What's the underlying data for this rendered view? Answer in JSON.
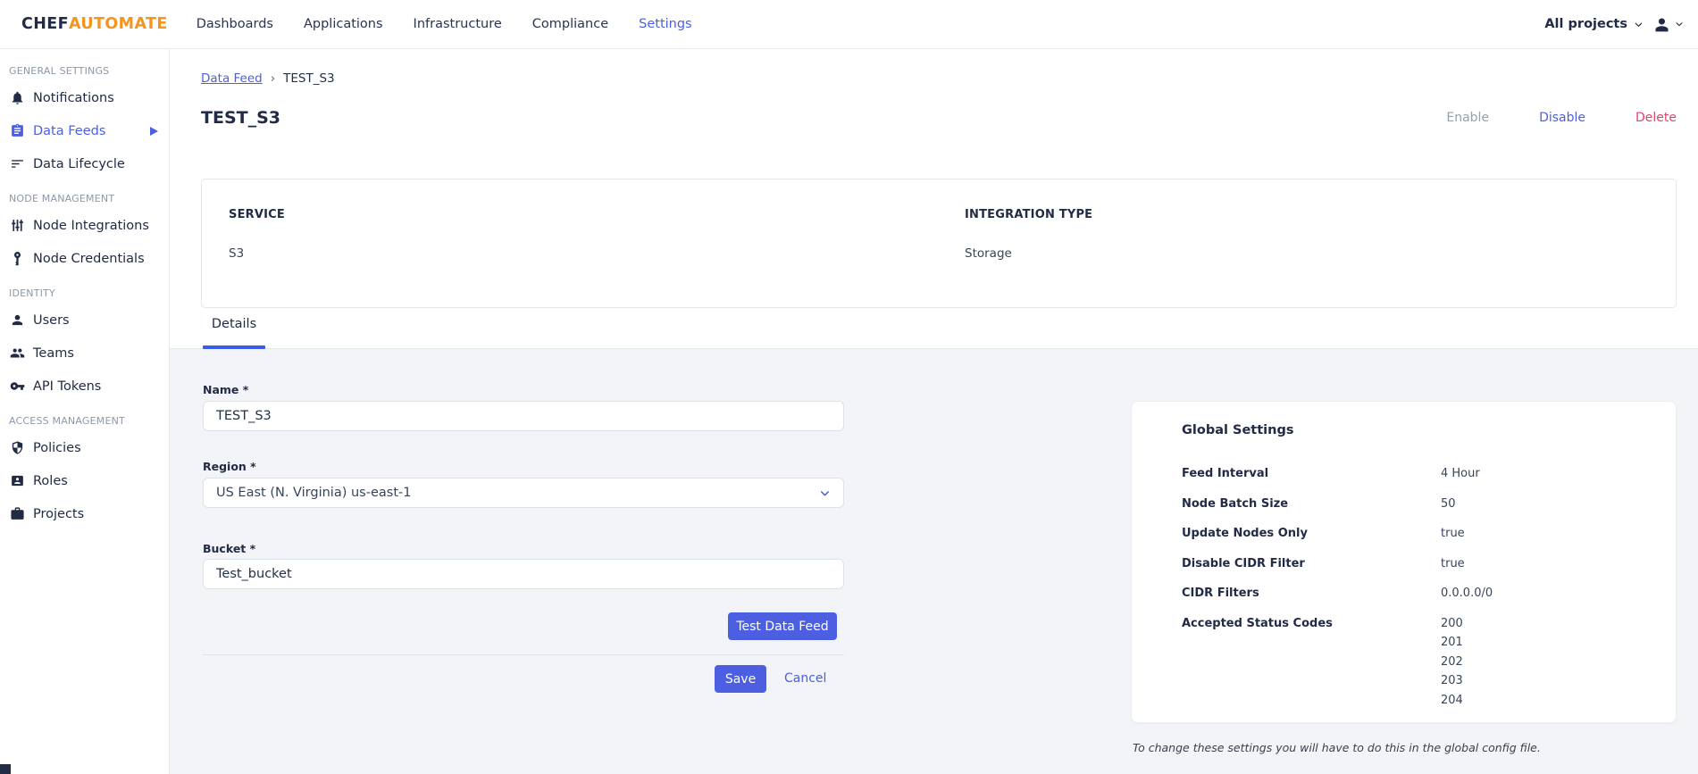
{
  "brand": {
    "chef": "CHEF",
    "automate": "AUTOMATE"
  },
  "navbar": {
    "items": [
      {
        "label": "Dashboards",
        "active": false
      },
      {
        "label": "Applications",
        "active": false
      },
      {
        "label": "Infrastructure",
        "active": false
      },
      {
        "label": "Compliance",
        "active": false
      },
      {
        "label": "Settings",
        "active": true
      }
    ],
    "projects_filter": "All projects",
    "icons": [
      "chevron-down-icon",
      "user-avatar-icon",
      "chevron-down-icon"
    ]
  },
  "sidebar": {
    "sections": [
      {
        "heading": "GENERAL SETTINGS",
        "items": [
          {
            "label": "Notifications",
            "icon": "bell-icon",
            "active": false
          },
          {
            "label": "Data Feeds",
            "icon": "clipboard-icon",
            "active": true,
            "expanded_arrow": "right-triangle-icon"
          },
          {
            "label": "Data Lifecycle",
            "icon": "list-icon",
            "active": false
          }
        ]
      },
      {
        "heading": "NODE MANAGEMENT",
        "items": [
          {
            "label": "Node Integrations",
            "icon": "sliders-icon",
            "active": false
          },
          {
            "label": "Node Credentials",
            "icon": "key-vertical-icon",
            "active": false
          }
        ]
      },
      {
        "heading": "IDENTITY",
        "items": [
          {
            "label": "Users",
            "icon": "user-icon",
            "active": false
          },
          {
            "label": "Teams",
            "icon": "team-icon",
            "active": false
          },
          {
            "label": "API Tokens",
            "icon": "key-icon",
            "active": false
          }
        ]
      },
      {
        "heading": "ACCESS MANAGEMENT",
        "items": [
          {
            "label": "Policies",
            "icon": "shield-icon",
            "active": false
          },
          {
            "label": "Roles",
            "icon": "badge-icon",
            "active": false
          },
          {
            "label": "Projects",
            "icon": "briefcase-icon",
            "active": false
          }
        ]
      }
    ]
  },
  "breadcrumb": {
    "link": "Data Feed",
    "separator": "›",
    "current": "TEST_S3"
  },
  "page": {
    "title": "TEST_S3",
    "actions": {
      "enable": "Enable",
      "disable": "Disable",
      "delete": "Delete"
    }
  },
  "summary_card": {
    "service_label": "SERVICE",
    "service_value": "S3",
    "integration_label": "INTEGRATION TYPE",
    "integration_value": "Storage"
  },
  "tabs": [
    {
      "label": "Details",
      "active": true
    }
  ],
  "form": {
    "name": {
      "label": "Name *",
      "value": "TEST_S3"
    },
    "region": {
      "label": "Region *",
      "value": "US East (N. Virginia) us-east-1"
    },
    "bucket": {
      "label": "Bucket *",
      "value": "Test_bucket"
    },
    "test_button": "Test Data Feed",
    "save_button": "Save",
    "cancel_button": "Cancel"
  },
  "global_settings": {
    "title": "Global Settings",
    "rows": [
      {
        "label": "Feed Interval",
        "values": [
          "4 Hour"
        ]
      },
      {
        "label": "Node Batch Size",
        "values": [
          "50"
        ]
      },
      {
        "label": "Update Nodes Only",
        "values": [
          "true"
        ]
      },
      {
        "label": "Disable CIDR Filter",
        "values": [
          "true"
        ]
      },
      {
        "label": "CIDR Filters",
        "values": [
          "0.0.0.0/0"
        ]
      },
      {
        "label": "Accepted Status Codes",
        "values": [
          "200",
          "201",
          "202",
          "203",
          "204"
        ]
      }
    ],
    "note": "To change these settings you will have to do this in the global config file."
  },
  "colors": {
    "primary_blue": "#4c5fe2",
    "brand_orange": "#f7941e",
    "brand_navy": "#222b45",
    "delete_pink": "#e5426e",
    "muted_gray": "#97a0ac",
    "background_gray": "#f2f4f8"
  }
}
